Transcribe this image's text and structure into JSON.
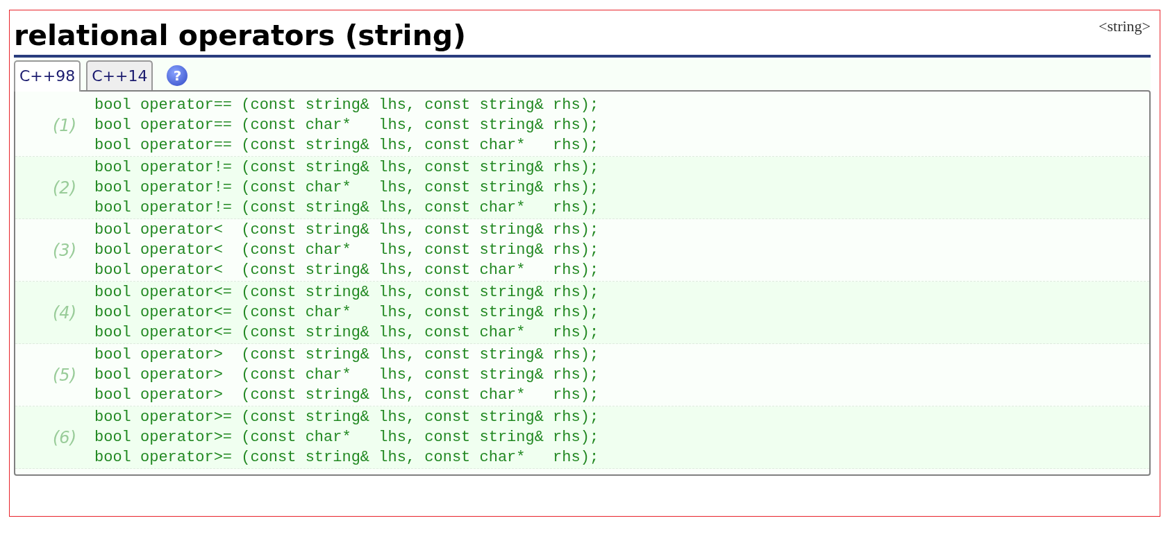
{
  "title": "relational operators (string)",
  "header_link": "<string>",
  "tabs": [
    {
      "label": "C++98",
      "selected": true
    },
    {
      "label": "C++14",
      "selected": false
    }
  ],
  "help": {
    "symbol": "?"
  },
  "groups": [
    {
      "label": "(1)",
      "lines": [
        "bool operator== (const string& lhs, const string& rhs);",
        "bool operator== (const char*   lhs, const string& rhs);",
        "bool operator== (const string& lhs, const char*   rhs);"
      ]
    },
    {
      "label": "(2)",
      "lines": [
        "bool operator!= (const string& lhs, const string& rhs);",
        "bool operator!= (const char*   lhs, const string& rhs);",
        "bool operator!= (const string& lhs, const char*   rhs);"
      ]
    },
    {
      "label": "(3)",
      "lines": [
        "bool operator<  (const string& lhs, const string& rhs);",
        "bool operator<  (const char*   lhs, const string& rhs);",
        "bool operator<  (const string& lhs, const char*   rhs);"
      ]
    },
    {
      "label": "(4)",
      "lines": [
        "bool operator<= (const string& lhs, const string& rhs);",
        "bool operator<= (const char*   lhs, const string& rhs);",
        "bool operator<= (const string& lhs, const char*   rhs);"
      ]
    },
    {
      "label": "(5)",
      "lines": [
        "bool operator>  (const string& lhs, const string& rhs);",
        "bool operator>  (const char*   lhs, const string& rhs);",
        "bool operator>  (const string& lhs, const char*   rhs);"
      ]
    },
    {
      "label": "(6)",
      "lines": [
        "bool operator>= (const string& lhs, const string& rhs);",
        "bool operator>= (const char*   lhs, const string& rhs);",
        "bool operator>= (const string& lhs, const char*   rhs);"
      ]
    }
  ]
}
